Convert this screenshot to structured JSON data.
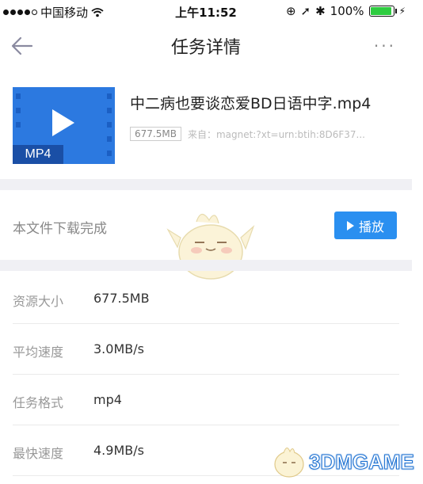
{
  "status_bar": {
    "carrier": "中国移动",
    "time": "上午11:52",
    "battery": "100%"
  },
  "nav": {
    "title": "任务详情",
    "more": "···"
  },
  "file": {
    "name": "中二病也要谈恋爱BD日语中字.mp4",
    "size_badge": "677.5MB",
    "source": "来自：magnet:?xt=urn:btih:8D6F37...",
    "thumb_label": "MP4"
  },
  "download": {
    "status": "本文件下载完成",
    "play_label": "播放"
  },
  "details": [
    {
      "key": "资源大小",
      "value": "677.5MB"
    },
    {
      "key": "平均速度",
      "value": "3.0MB/s"
    },
    {
      "key": "任务格式",
      "value": "mp4"
    },
    {
      "key": "最快速度",
      "value": "4.9MB/s"
    }
  ],
  "watermark": {
    "text": "3DMGAME"
  },
  "colors": {
    "accent": "#2a8ff0",
    "thumb": "#2c79e0",
    "separator": "#f0f0f4"
  }
}
